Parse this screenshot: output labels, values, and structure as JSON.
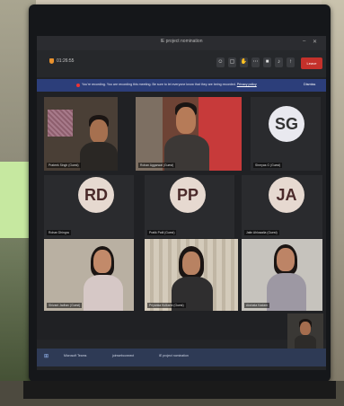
{
  "window": {
    "title": "IE project nomination"
  },
  "toolbar": {
    "timer": "01:26:55",
    "leave_label": "Leave",
    "icons": [
      "people-icon",
      "chat-icon",
      "hand-icon",
      "more-icon",
      "camera-icon",
      "mic-icon",
      "share-icon"
    ]
  },
  "recording_banner": {
    "text": "You're recording. You are recording this meeting. Be sure to let everyone know that they are being recorded.",
    "link": "Privacy policy",
    "dismiss": "Dismiss"
  },
  "participants": [
    {
      "id": "p1",
      "name": "Prateek Singh (Guest)",
      "type": "video"
    },
    {
      "id": "p2",
      "name": "Rohan Aggarwal (Guest)",
      "type": "video"
    },
    {
      "id": "p3",
      "name": "Shreyas G (Guest)",
      "type": "avatar",
      "initials": "SG"
    },
    {
      "id": "p4",
      "name": "Rohan Dhingra",
      "type": "avatar",
      "initials": "RD"
    },
    {
      "id": "p5",
      "name": "Pratik Patil (Guest)",
      "type": "avatar",
      "initials": "PP"
    },
    {
      "id": "p6",
      "name": "Jatin Ahluwalia (Guest)",
      "type": "avatar",
      "initials": "JA"
    },
    {
      "id": "p7",
      "name": "Shivani Jadhav (Guest)",
      "type": "video"
    },
    {
      "id": "p8",
      "name": "Priyanka Kulkarni (Guest)",
      "type": "video"
    },
    {
      "id": "p9",
      "name": "Akshata Kadam",
      "type": "video"
    }
  ],
  "reactions": {
    "icons": [
      "clap-icon",
      "heart-icon",
      "like-icon",
      "laugh-icon"
    ]
  },
  "taskbar": {
    "items": [
      "Microsoft Teams",
      "joinwebconnect",
      "IE project nomination"
    ]
  }
}
